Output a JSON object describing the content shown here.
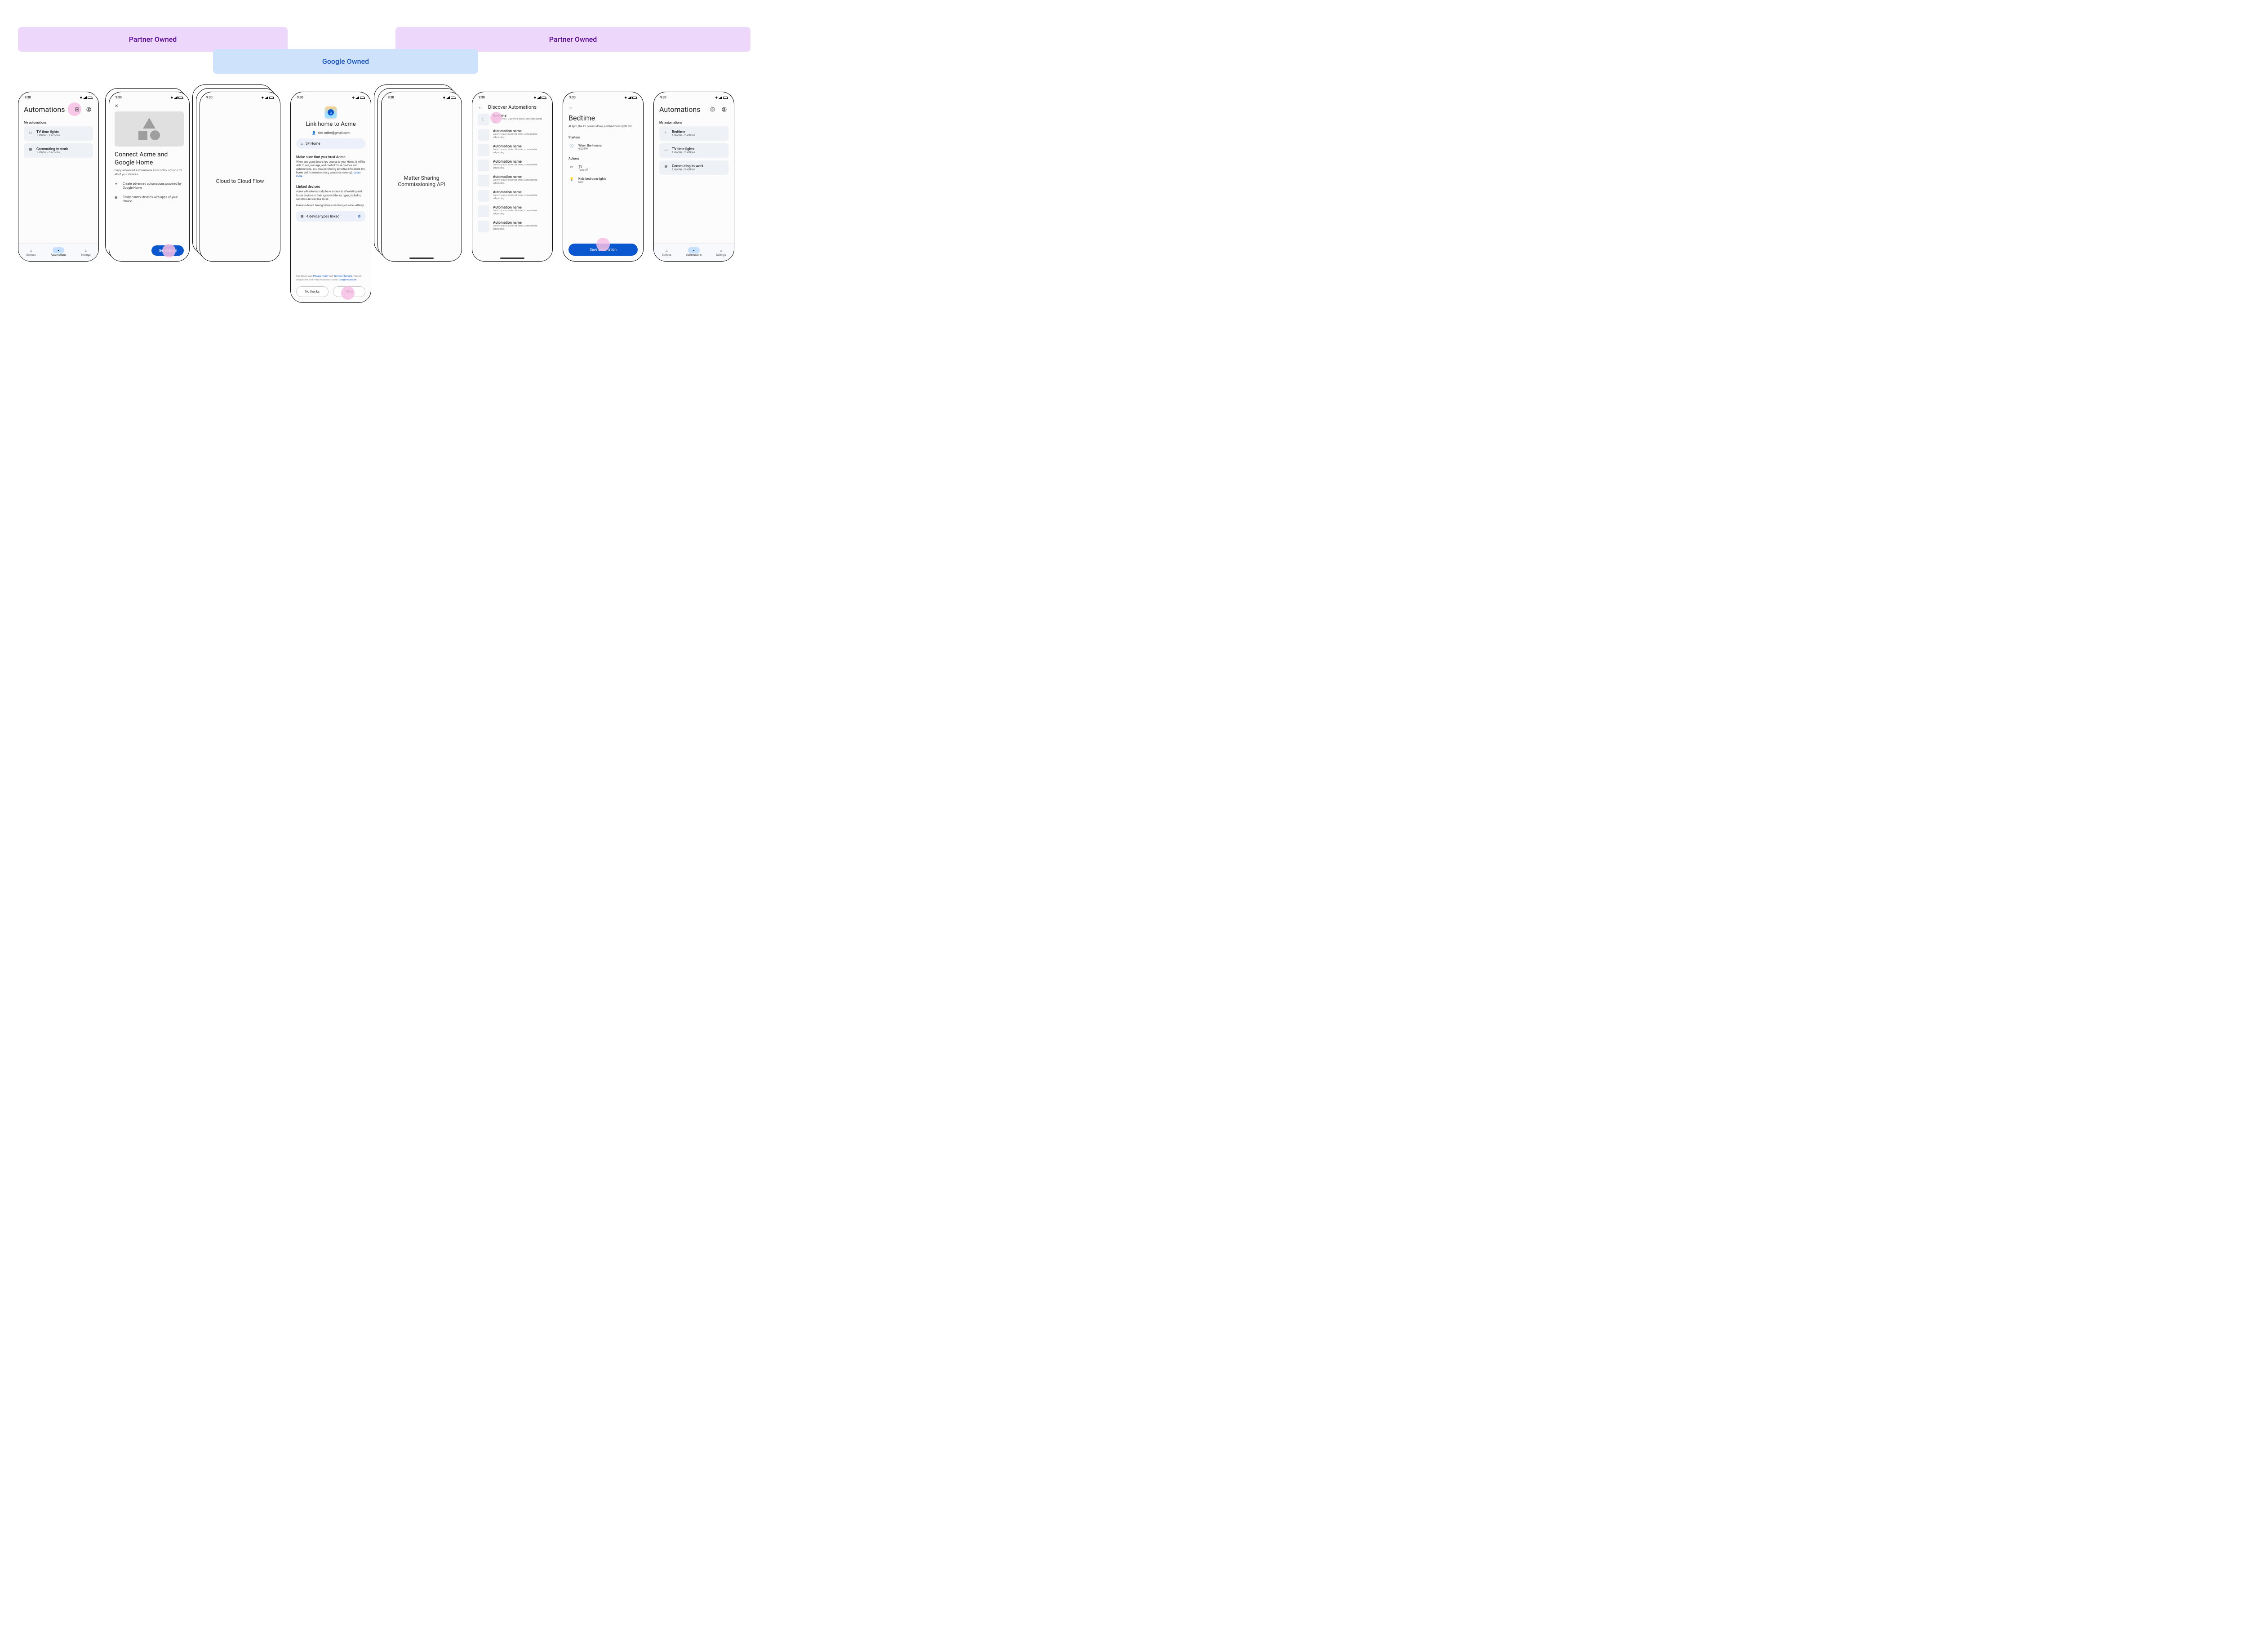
{
  "banners": {
    "partner1": "Partner Owned",
    "google": "Google Owned",
    "partner2": "Partner Owned"
  },
  "status": {
    "time": "9:30"
  },
  "screen1": {
    "title": "Automations",
    "section": "My automations",
    "items": [
      {
        "icon": "tv",
        "title": "TV time lights",
        "sub": "1 starter • 2 actions"
      },
      {
        "icon": "car",
        "title": "Commuting to work",
        "sub": "1 starter • 3 actions"
      }
    ],
    "nav": {
      "devices": "Devices",
      "automations": "Automations",
      "settings": "Settings"
    }
  },
  "screen2": {
    "title": "Connect Acme and Google Home",
    "body": "Enjoy advanced automations and control options for all of your devices",
    "feat1": "Create advanced automations powered by Google Home",
    "feat2": "Easily control devices with apps of your choice",
    "cta": "Get started"
  },
  "screen3": {
    "title": "Cloud to Cloud Flow"
  },
  "screen4": {
    "title": "Link home to Acme",
    "email": "alex.miller@gmail.com",
    "home": "SF Home",
    "trust_h": "Make sure that you trust Acme",
    "trust_p1": "When you grant Smart App access to your Home, it will be able to  see, manage, and control those devices and automations. You may be sharing sensitive info about the home and its members (e.g. presence sensing). ",
    "trust_link": "Learn more",
    "linked_h": "Linked devices",
    "linked_p1": "Acme will automatically have access to all existing and future devices in their approved device types, including sensitive devices like locks.",
    "linked_p2": "Manage device linking below or in Google Home settings.",
    "linked_card": "4 device types linked",
    "footer1": "See Smart App ",
    "footer_pp": "Privacy Policy",
    "footer_and": " and ",
    "footer_tos": "Terms of Service",
    "footer2": ". You can always see and remove access in your ",
    "footer_ga": "Google Account",
    "footer3": ".",
    "no": "No thanks",
    "allow": "Allow"
  },
  "screen5": {
    "line1": "Matter Sharing",
    "line2": "Commissioning API"
  },
  "screen6": {
    "title": "Discover Automations",
    "featured": {
      "icon": "moon",
      "title": "Bedtime",
      "sub": "At 9pm, the TV powers down, bedroom lights dim."
    },
    "items": [
      {
        "title": "Automation name",
        "sub": "Lorem ipsum dolor sit amet, consectetur adipiscing."
      },
      {
        "title": "Automation name",
        "sub": "Lorem ipsum dolor sit amet, consectetur adipiscing."
      },
      {
        "title": "Automation name",
        "sub": "Lorem ipsum dolor sit amet, consectetur adipiscing."
      },
      {
        "title": "Automation name",
        "sub": "Lorem ipsum dolor sit amet, consectetur adipiscing."
      },
      {
        "title": "Automation name",
        "sub": "Lorem ipsum dolor sit amet, consectetur adipiscing."
      },
      {
        "title": "Automation name",
        "sub": "Lorem ipsum dolor sit amet, consectetur adipiscing."
      },
      {
        "title": "Automation name",
        "sub": "Lorem ipsum dolor sit amet, consectetur adipiscing."
      }
    ]
  },
  "screen7": {
    "title": "Bedtime",
    "desc": "At 9pm, the TV powers down, and bedroom lights dim.",
    "starters_h": "Starters",
    "starter": {
      "t": "When the time is",
      "s": "9:00 PM"
    },
    "actions_h": "Actions",
    "a1": {
      "t": "TV",
      "s": "Turn off"
    },
    "a2": {
      "t": "Kids bedroom lights",
      "s": "Dim"
    },
    "save": "Save automation"
  },
  "screen8": {
    "title": "Automations",
    "section": "My automations",
    "items": [
      {
        "icon": "moon",
        "title": "Bedtime",
        "sub": "1 starter • 2 actions"
      },
      {
        "icon": "tv",
        "title": "TV time lights",
        "sub": "1 starter • 2 actions"
      },
      {
        "icon": "car",
        "title": "Commuting to work",
        "sub": "1 starter • 3 actions"
      }
    ]
  }
}
